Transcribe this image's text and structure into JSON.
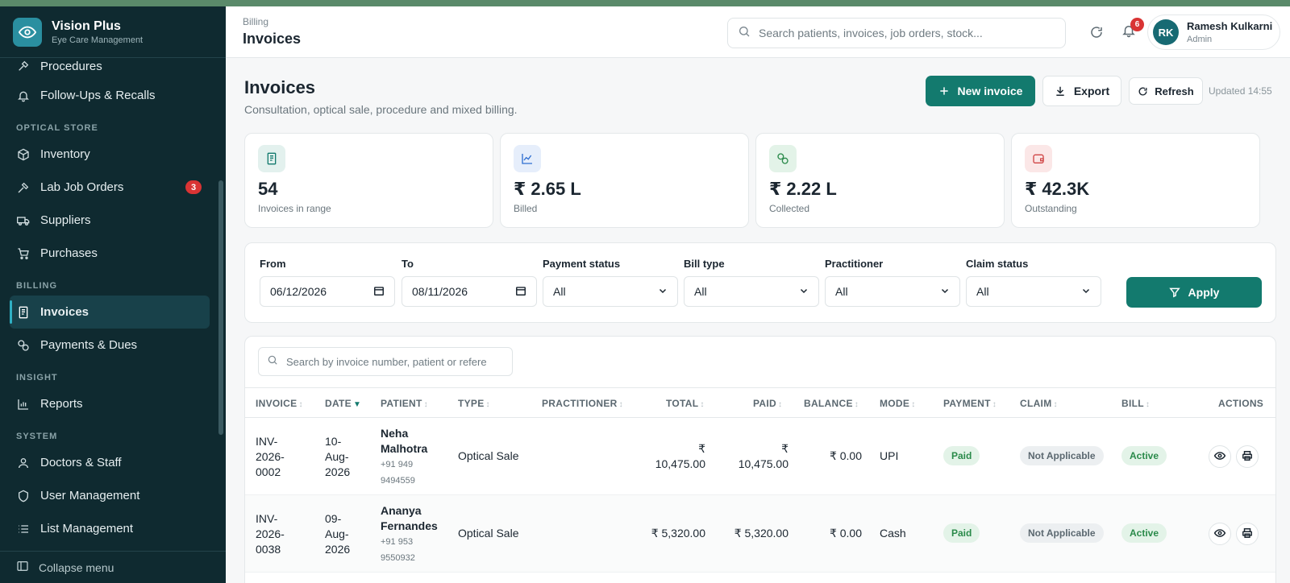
{
  "brand": {
    "name": "Vision Plus",
    "subtitle": "Eye Care Management"
  },
  "sidebar": {
    "items_top": [
      {
        "label": "Procedures",
        "icon": "procedures-icon"
      },
      {
        "label": "Follow-Ups & Recalls",
        "icon": "bell-icon"
      }
    ],
    "sections": [
      {
        "title": "OPTICAL STORE",
        "items": [
          {
            "label": "Inventory",
            "icon": "box-icon"
          },
          {
            "label": "Lab Job Orders",
            "icon": "hammer-icon",
            "badge": "3"
          },
          {
            "label": "Suppliers",
            "icon": "truck-icon"
          },
          {
            "label": "Purchases",
            "icon": "cart-icon"
          }
        ]
      },
      {
        "title": "BILLING",
        "items": [
          {
            "label": "Invoices",
            "icon": "invoice-icon",
            "active": true
          },
          {
            "label": "Payments & Dues",
            "icon": "coins-icon"
          }
        ]
      },
      {
        "title": "INSIGHT",
        "items": [
          {
            "label": "Reports",
            "icon": "bar-chart-icon"
          }
        ]
      },
      {
        "title": "SYSTEM",
        "items": [
          {
            "label": "Doctors & Staff",
            "icon": "user-icon"
          },
          {
            "label": "User Management",
            "icon": "shield-icon"
          },
          {
            "label": "List Management",
            "icon": "list-icon"
          }
        ]
      }
    ],
    "collapse_label": "Collapse menu"
  },
  "header": {
    "breadcrumb": "Billing",
    "title": "Invoices",
    "search_placeholder": "Search patients, invoices, job orders, stock...",
    "notification_count": "6",
    "user": {
      "initials": "RK",
      "name": "Ramesh Kulkarni",
      "role": "Admin"
    }
  },
  "page": {
    "title": "Invoices",
    "subtitle": "Consultation, optical sale, procedure and mixed billing.",
    "new_invoice_label": "New invoice",
    "export_label": "Export",
    "refresh_label": "Refresh",
    "updated": "Updated 14:55"
  },
  "stats": [
    {
      "value": "54",
      "label": "Invoices in range",
      "icon": "invoice-icon",
      "color": "#137a6e",
      "bg": "#e3f1ee"
    },
    {
      "value": "₹ 2.65 L",
      "label": "Billed",
      "icon": "line-chart-icon",
      "color": "#2f6fd1",
      "bg": "#e6eefb"
    },
    {
      "value": "₹ 2.22 L",
      "label": "Collected",
      "icon": "coins-icon",
      "color": "#2a8a4a",
      "bg": "#e3f3e8"
    },
    {
      "value": "₹ 42.3K",
      "label": "Outstanding",
      "icon": "wallet-icon",
      "color": "#d04545",
      "bg": "#fbe7e7"
    }
  ],
  "filters": {
    "from_label": "From",
    "from_value": "06/12/2026",
    "to_label": "To",
    "to_value": "08/11/2026",
    "payment_status_label": "Payment status",
    "payment_status_value": "All",
    "bill_type_label": "Bill type",
    "bill_type_value": "All",
    "practitioner_label": "Practitioner",
    "practitioner_value": "All",
    "claim_status_label": "Claim status",
    "claim_status_value": "All",
    "apply_label": "Apply"
  },
  "table": {
    "search_placeholder": "Search by invoice number, patient or refere",
    "columns": [
      "INVOICE",
      "DATE",
      "PATIENT",
      "TYPE",
      "PRACTITIONER",
      "TOTAL",
      "PAID",
      "BALANCE",
      "MODE",
      "PAYMENT",
      "CLAIM",
      "BILL",
      "ACTIONS"
    ],
    "rows": [
      {
        "invoice": [
          "INV-",
          "2026-",
          "0002"
        ],
        "date": [
          "10-",
          "Aug-",
          "2026"
        ],
        "patient_name": [
          "Neha",
          "Malhotra"
        ],
        "patient_phone": [
          "+91 949",
          "9494559"
        ],
        "type": "Optical Sale",
        "practitioner": "",
        "total": [
          "₹",
          "10,475.00"
        ],
        "paid": [
          "₹",
          "10,475.00"
        ],
        "balance": "₹ 0.00",
        "mode": "UPI",
        "payment": "Paid",
        "claim": "Not Applicable",
        "bill": "Active"
      },
      {
        "invoice": [
          "INV-",
          "2026-",
          "0038"
        ],
        "date": [
          "09-",
          "Aug-",
          "2026"
        ],
        "patient_name": [
          "Ananya",
          "Fernandes"
        ],
        "patient_phone": [
          "+91 953",
          "9550932"
        ],
        "type": "Optical Sale",
        "practitioner": "",
        "total": [
          "",
          "₹ 5,320.00"
        ],
        "paid": [
          "",
          "₹ 5,320.00"
        ],
        "balance": "₹ 0.00",
        "mode": "Cash",
        "payment": "Paid",
        "claim": "Not Applicable",
        "bill": "Active"
      }
    ]
  }
}
